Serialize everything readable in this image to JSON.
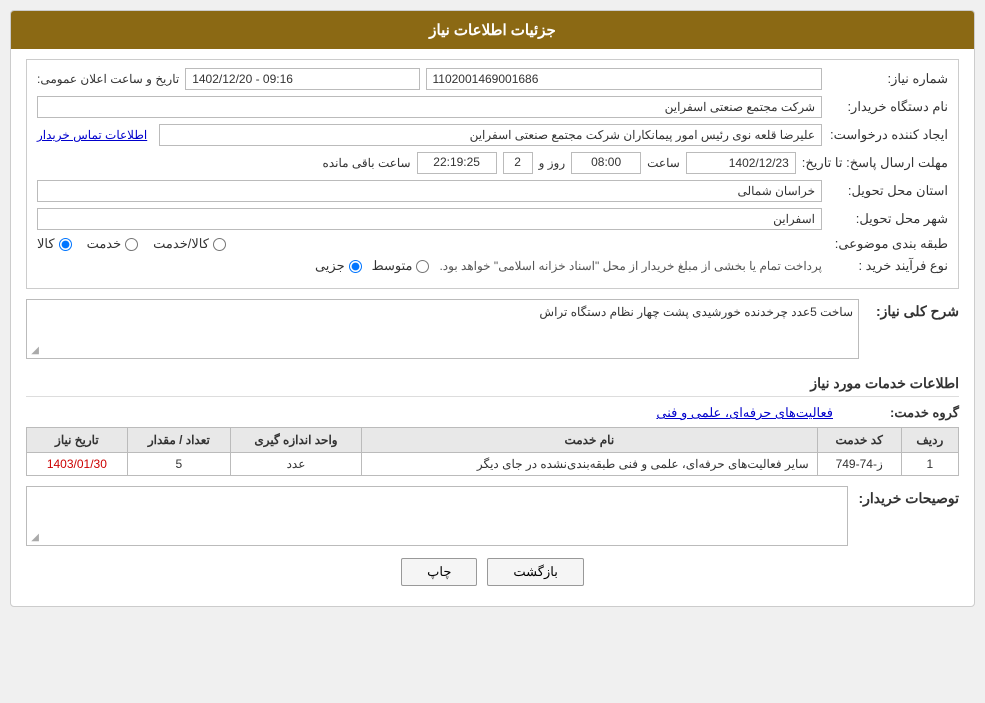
{
  "header": {
    "title": "جزئیات اطلاعات نیاز"
  },
  "form": {
    "fields": {
      "need_number_label": "شماره نیاز:",
      "need_number_value": "1102001469001686",
      "buyer_org_label": "نام دستگاه خریدار:",
      "buyer_org_value": "شرکت مجتمع صنعتی اسفراین",
      "creator_label": "ایجاد کننده درخواست:",
      "creator_value": "علیرضا قلعه نوی رئیس امور پیمانکاران شرکت مجتمع صنعتی اسفراین",
      "creator_link": "اطلاعات تماس خریدار",
      "response_deadline_label": "مهلت ارسال پاسخ: تا تاریخ:",
      "response_date": "1402/12/23",
      "response_time_label": "ساعت",
      "response_time": "08:00",
      "response_days_label": "روز و",
      "response_days": "2",
      "response_remaining_label": "ساعت باقی مانده",
      "response_remaining": "22:19:25",
      "announce_label": "تاریخ و ساعت اعلان عمومی:",
      "announce_value": "1402/12/20 - 09:16",
      "province_label": "استان محل تحویل:",
      "province_value": "خراسان شمالی",
      "city_label": "شهر محل تحویل:",
      "city_value": "اسفراین",
      "category_label": "طبقه بندی موضوعی:",
      "category_radio1": "کالا",
      "category_radio2": "خدمت",
      "category_radio3": "کالا/خدمت",
      "purchase_type_label": "نوع فرآیند خرید :",
      "purchase_type_radio1": "جزیی",
      "purchase_type_radio2": "متوسط",
      "purchase_type_notice": "پرداخت تمام یا بخشی از مبلغ خریدار از محل \"اسناد خزانه اسلامی\" خواهد بود."
    },
    "description_section": {
      "title": "شرح کلی نیاز:",
      "value": "ساخت 5عدد چرخدنده خورشیدی پشت چهار نظام دستگاه تراش"
    },
    "services_section": {
      "title": "اطلاعات خدمات مورد نیاز",
      "service_group_label": "گروه خدمت:",
      "service_group_value": "فعالیت‌های حرفه‌ای، علمی و فنی",
      "table_headers": [
        "ردیف",
        "کد خدمت",
        "نام خدمت",
        "واحد اندازه گیری",
        "تعداد / مقدار",
        "تاریخ نیاز"
      ],
      "table_rows": [
        {
          "row": "1",
          "code": "ز-74-749",
          "name": "سایر فعالیت‌های حرفه‌ای، علمی و فنی طبقه‌بندی‌نشده در جای دیگر",
          "unit": "عدد",
          "quantity": "5",
          "date": "1403/01/30"
        }
      ]
    },
    "buyer_notes": {
      "label": "توصیحات خریدار:"
    }
  },
  "buttons": {
    "print": "چاپ",
    "back": "بازگشت"
  }
}
